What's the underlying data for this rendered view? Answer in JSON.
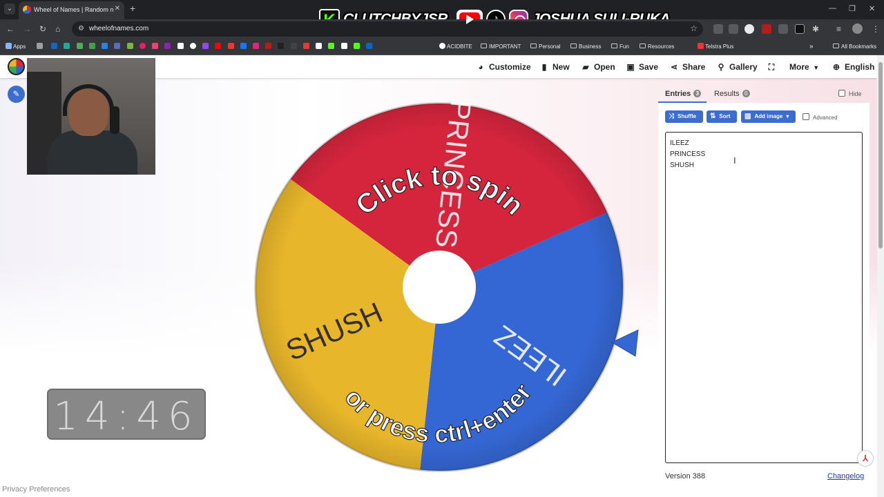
{
  "browser": {
    "tab_title": "Wheel of Names | Random name picker",
    "url": "wheelofnames.com",
    "bookmarks": [
      {
        "label": "Apps",
        "icon": "apps-grid-icon"
      },
      {
        "label": "ACIDBITE",
        "icon": "acidbite-icon"
      },
      {
        "label": "IMPORTANT",
        "icon": "folder-icon"
      },
      {
        "label": "Personal",
        "icon": "folder-icon"
      },
      {
        "label": "Business",
        "icon": "folder-icon"
      },
      {
        "label": "Fun",
        "icon": "folder-icon"
      },
      {
        "label": "Resources",
        "icon": "folder-icon"
      },
      {
        "label": "Telstra Plus",
        "icon": "telstra-icon"
      },
      {
        "label": "All Bookmarks",
        "icon": "folder-icon"
      }
    ]
  },
  "overlay": {
    "channel": "CLUTCHBYJSR",
    "socials_name": "JOSHUA SULI-RUKA",
    "clock": "14:46"
  },
  "menu": {
    "customize": "Customize",
    "new": "New",
    "open": "Open",
    "save": "Save",
    "share": "Share",
    "gallery": "Gallery",
    "more": "More",
    "language": "English"
  },
  "wheel": {
    "entries": [
      {
        "label": "PRINCESS",
        "color": "#d5253d"
      },
      {
        "label": "ILEEZ",
        "color": "#3567d4"
      },
      {
        "label": "SHUSH",
        "color": "#e8b62b"
      }
    ],
    "prompt_top": "Click to spin",
    "prompt_bottom": "or press ctrl+enter"
  },
  "panel": {
    "tab_entries": "Entries",
    "entries_count": "3",
    "tab_results": "Results",
    "results_count": "0",
    "hide_label": "Hide",
    "shuffle": "Shuffle",
    "sort": "Sort",
    "add_image": "Add image",
    "advanced": "Advanced",
    "entries_text": [
      "ILEEZ",
      "PRINCESS",
      "SHUSH"
    ],
    "version": "Version 388",
    "changelog": "Changelog"
  },
  "footer": {
    "privacy": "Privacy Preferences"
  },
  "colors": {
    "accent": "#3b6cd1",
    "red": "#d5253d",
    "blue": "#3567d4",
    "yellow": "#e8b62b"
  }
}
